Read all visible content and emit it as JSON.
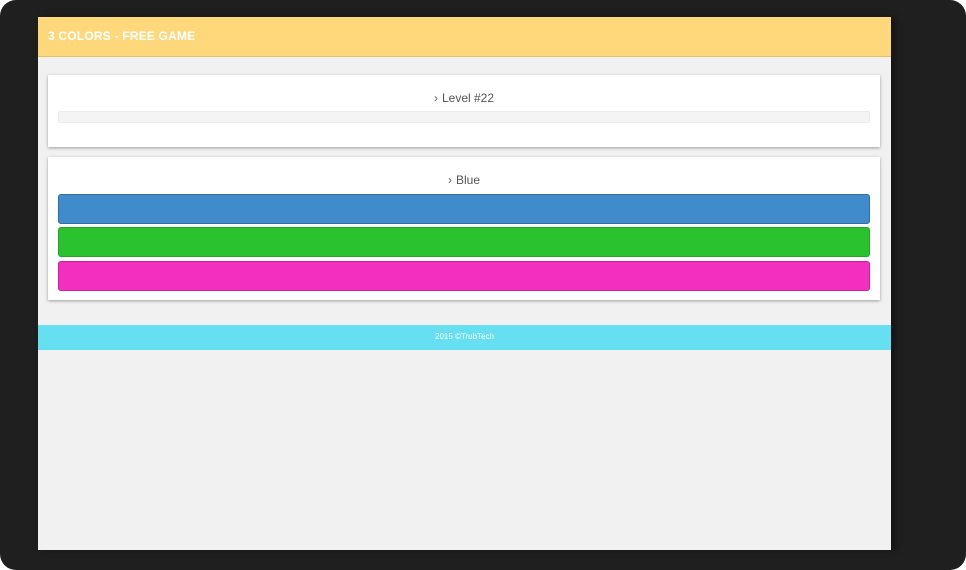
{
  "app": {
    "title": "3 COLORS - FREE GAME"
  },
  "level": {
    "chevron": "›",
    "label": "Level #22",
    "progress": 0
  },
  "prompt": {
    "chevron": "›",
    "color_name": "Blue"
  },
  "color_buttons": [
    {
      "name": "blue",
      "color": "#3f8bcb"
    },
    {
      "name": "green",
      "color": "#2bc22f"
    },
    {
      "name": "pink",
      "color": "#f22fbe"
    }
  ],
  "footer": {
    "text": "2015 ©TrubTech"
  },
  "colors": {
    "header": "#ffd87b",
    "footer": "#66dff0",
    "frame": "#1f1f1f",
    "background": "#f1f1f1"
  }
}
